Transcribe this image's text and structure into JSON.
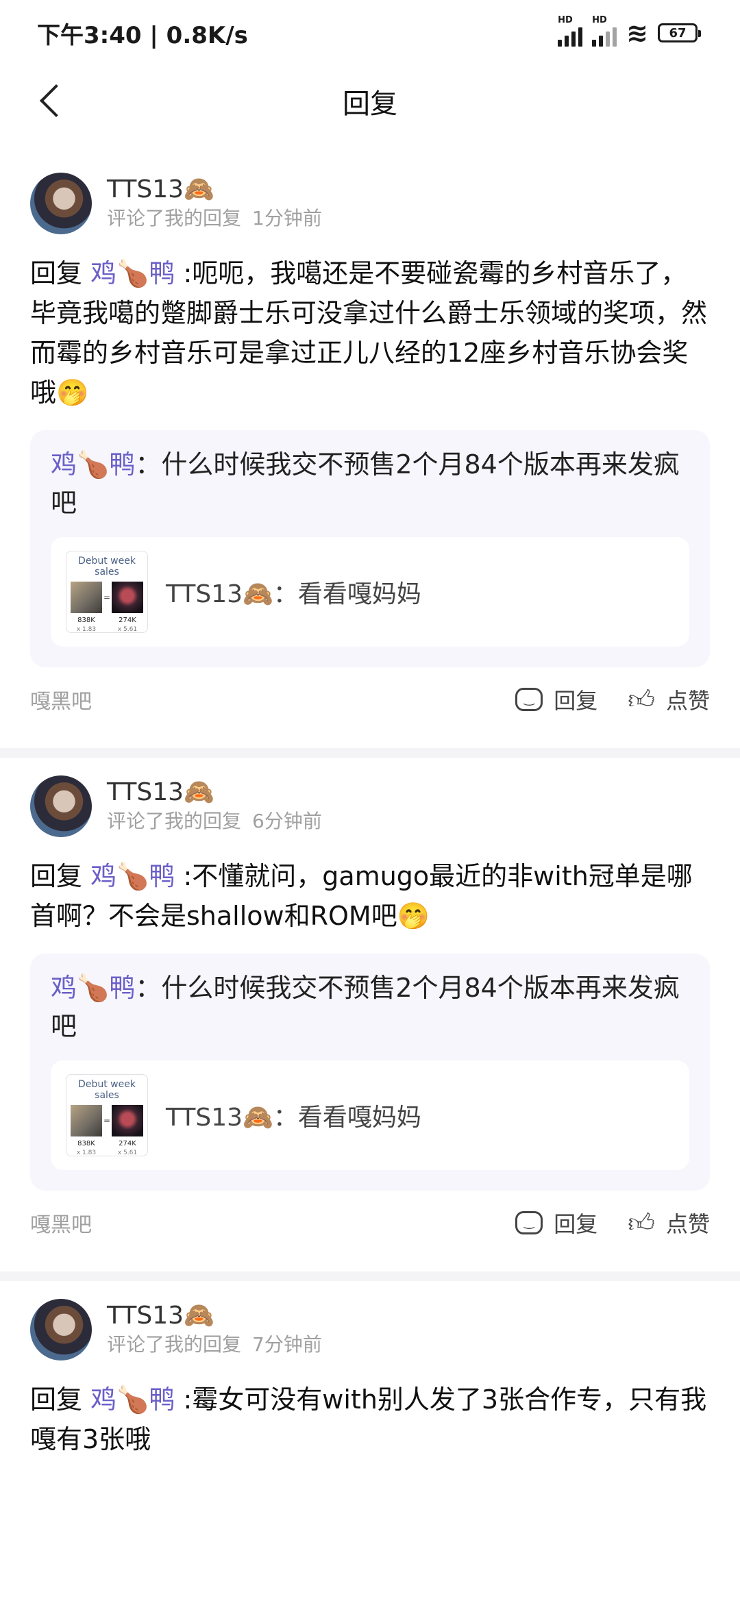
{
  "status_bar": {
    "time_speed": "下午3:40 | 0.8K/s",
    "signal1": "HD",
    "signal2": "HD",
    "battery": "67"
  },
  "header": {
    "title": "回复"
  },
  "cards": [
    {
      "username": "TTS13🙈",
      "action": "评论了我的回复",
      "time": "1分钟前",
      "reply_prefix": "回复 ",
      "mention": "鸡🍗鸭",
      "text": " :呃呃，我噶还是不要碰瓷霉的乡村音乐了，毕竟我噶的蹩脚爵士乐可没拿过什么爵士乐领域的奖项，然而霉的乡村音乐可是拿过正儿八经的12座乡村音乐协会奖哦🤭",
      "quote_name": "鸡🍗鸭",
      "quote_text": "：什么时候我交不预售2个月84个版本再来发疯吧",
      "thumb_title": "Debut week sales",
      "thumb_eq": "=",
      "thumb_a_value": "838K",
      "thumb_a_mult": "x 1.83",
      "thumb_b_value": "274K",
      "thumb_b_mult": "x 5.61",
      "inner_text": "TTS13🙈：看看嘎妈妈",
      "tag": "嘎黑吧",
      "reply_label": "回复",
      "like_label": "点赞"
    },
    {
      "username": "TTS13🙈",
      "action": "评论了我的回复",
      "time": "6分钟前",
      "reply_prefix": "回复 ",
      "mention": "鸡🍗鸭",
      "text": " :不懂就问，gamugo最近的非with冠单是哪首啊？不会是shallow和ROM吧🤭",
      "quote_name": "鸡🍗鸭",
      "quote_text": "：什么时候我交不预售2个月84个版本再来发疯吧",
      "thumb_title": "Debut week sales",
      "thumb_eq": "=",
      "thumb_a_value": "838K",
      "thumb_a_mult": "x 1.83",
      "thumb_b_value": "274K",
      "thumb_b_mult": "x 5.61",
      "inner_text": "TTS13🙈：看看嘎妈妈",
      "tag": "嘎黑吧",
      "reply_label": "回复",
      "like_label": "点赞"
    },
    {
      "username": "TTS13🙈",
      "action": "评论了我的回复",
      "time": "7分钟前",
      "reply_prefix": "回复 ",
      "mention": "鸡🍗鸭",
      "text": " :霉女可没有with别人发了3张合作专，只有我嘎有3张哦"
    }
  ]
}
